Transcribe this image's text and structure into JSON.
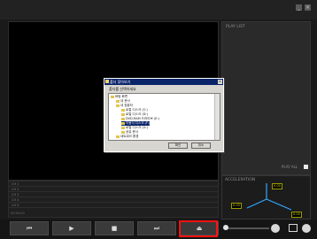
{
  "side_panel": {
    "title": "PLAY LIST",
    "checkbox_label": "PLAY ALL"
  },
  "accel_panel": {
    "title": "ACCELERATION",
    "readouts": [
      "0.00",
      "0.00",
      "0.00"
    ],
    "colors": {
      "x_axis": "#33a8ff",
      "y_axis": "#33a8ff",
      "z_axis": "#33a8ff",
      "readout_border": "#9a9a00",
      "readout_text": "#d6d600"
    }
  },
  "timeline": {
    "tracks": [
      "CH 1",
      "CH 2",
      "CH 3",
      "CH 4",
      "CH 5"
    ],
    "time_label": "00:00:00"
  },
  "controls": {
    "prev_icon": "⏮",
    "play_icon": "▶",
    "stop_icon": "■",
    "next_icon": "⏭",
    "eject_icon": "⏏",
    "highlight_color": "#ff1010"
  },
  "dialog": {
    "title": "폴더 찾아보기",
    "close": "×",
    "message": "폴더를 선택하세요",
    "tree": [
      {
        "label": "바탕 화면",
        "indent": 0
      },
      {
        "label": "내 문서",
        "indent": 1
      },
      {
        "label": "내 컴퓨터",
        "indent": 1
      },
      {
        "label": "로컬 디스크 (C:)",
        "indent": 2
      },
      {
        "label": "로컬 디스크 (D:)",
        "indent": 2
      },
      {
        "label": "DVD-RAM 드라이브 (E:)",
        "indent": 2
      },
      {
        "label": "이동식 디스크 (F:)",
        "indent": 2,
        "selected": true
      },
      {
        "label": "로컬 디스크 (G:)",
        "indent": 2
      },
      {
        "label": "공유 문서",
        "indent": 2
      },
      {
        "label": "네트워크 환경",
        "indent": 1
      }
    ],
    "ok": "확인",
    "cancel": "취소"
  }
}
